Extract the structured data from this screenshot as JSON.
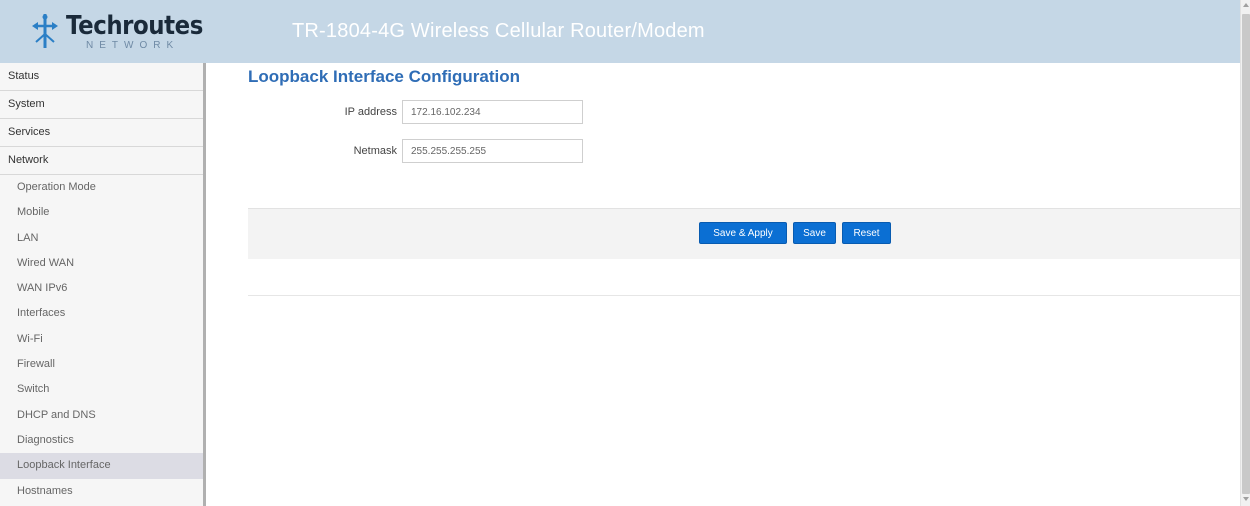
{
  "header": {
    "logo_text": "Techroutes",
    "logo_sub": "NETWORK",
    "title": "TR-1804-4G Wireless Cellular Router/Modem"
  },
  "sidebar": {
    "categories": [
      "Status",
      "System",
      "Services",
      "Network"
    ],
    "network_items": [
      "Operation Mode",
      "Mobile",
      "LAN",
      "Wired WAN",
      "WAN IPv6",
      "Interfaces",
      "Wi-Fi",
      "Firewall",
      "Switch",
      "DHCP and DNS",
      "Diagnostics",
      "Loopback Interface",
      "Hostnames"
    ],
    "active_item": "Loopback Interface"
  },
  "main": {
    "title": "Loopback Interface Configuration",
    "fields": {
      "ip_label": "IP address",
      "ip_value": "172.16.102.234",
      "netmask_label": "Netmask",
      "netmask_value": "255.255.255.255"
    },
    "buttons": {
      "save_apply": "Save & Apply",
      "save": "Save",
      "reset": "Reset"
    }
  },
  "colors": {
    "header_bg": "#c5d7e6",
    "title_blue": "#2f6db6",
    "button_blue": "#0b6fd3",
    "active_item_bg": "#dcdce4"
  }
}
